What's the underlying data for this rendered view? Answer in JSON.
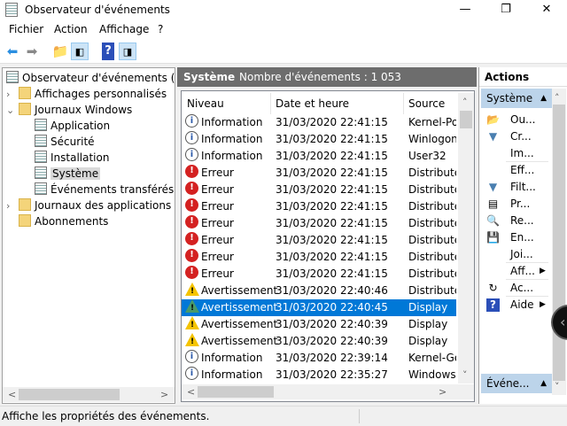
{
  "window": {
    "title": "Observateur d'événements",
    "minimize": "—",
    "maximize": "❐",
    "close": "✕"
  },
  "menu": [
    "Fichier",
    "Action",
    "Affichage",
    "?"
  ],
  "tree": [
    {
      "label": "Observateur d'événements (Local)",
      "level": 0,
      "icon": "event-viewer-icon"
    },
    {
      "label": "Affichages personnalisés",
      "level": 1,
      "icon": "folder-filter-icon",
      "chevron": "›"
    },
    {
      "label": "Journaux Windows",
      "level": 1,
      "icon": "folder-windows-icon",
      "chevron": "⌄"
    },
    {
      "label": "Application",
      "level": 2,
      "icon": "log-warning-icon"
    },
    {
      "label": "Sécurité",
      "level": 2,
      "icon": "log-warning-icon"
    },
    {
      "label": "Installation",
      "level": 2,
      "icon": "log-icon"
    },
    {
      "label": "Système",
      "level": 2,
      "icon": "log-warning-icon",
      "selected": true
    },
    {
      "label": "Événements transférés",
      "level": 2,
      "icon": "log-icon"
    },
    {
      "label": "Journaux des applications et services",
      "level": 1,
      "icon": "folder-icon",
      "chevron": "›"
    },
    {
      "label": "Abonnements",
      "level": 1,
      "icon": "subscriptions-icon"
    }
  ],
  "middle": {
    "title": "Système",
    "count": "Nombre d'événements : 1 053",
    "columns": [
      "Niveau",
      "Date et heure",
      "Source"
    ],
    "rows": [
      {
        "level": "Information",
        "type": "info",
        "date": "31/03/2020 22:41:15",
        "source": "Kernel-Power"
      },
      {
        "level": "Information",
        "type": "info",
        "date": "31/03/2020 22:41:15",
        "source": "Winlogon"
      },
      {
        "level": "Information",
        "type": "info",
        "date": "31/03/2020 22:41:15",
        "source": "User32"
      },
      {
        "level": "Erreur",
        "type": "err",
        "date": "31/03/2020 22:41:15",
        "source": "DistributedCOM"
      },
      {
        "level": "Erreur",
        "type": "err",
        "date": "31/03/2020 22:41:15",
        "source": "DistributedCOM"
      },
      {
        "level": "Erreur",
        "type": "err",
        "date": "31/03/2020 22:41:15",
        "source": "DistributedCOM"
      },
      {
        "level": "Erreur",
        "type": "err",
        "date": "31/03/2020 22:41:15",
        "source": "DistributedCOM"
      },
      {
        "level": "Erreur",
        "type": "err",
        "date": "31/03/2020 22:41:15",
        "source": "DistributedCOM"
      },
      {
        "level": "Erreur",
        "type": "err",
        "date": "31/03/2020 22:41:15",
        "source": "DistributedCOM"
      },
      {
        "level": "Erreur",
        "type": "err",
        "date": "31/03/2020 22:41:15",
        "source": "DistributedCOM"
      },
      {
        "level": "Avertissement",
        "type": "warn",
        "date": "31/03/2020 22:40:46",
        "source": "DistributedCOM"
      },
      {
        "level": "Avertissement",
        "type": "warn",
        "date": "31/03/2020 22:40:45",
        "source": "Display",
        "selected": true
      },
      {
        "level": "Avertissement",
        "type": "warn",
        "date": "31/03/2020 22:40:39",
        "source": "Display"
      },
      {
        "level": "Avertissement",
        "type": "warn",
        "date": "31/03/2020 22:40:39",
        "source": "Display"
      },
      {
        "level": "Information",
        "type": "info",
        "date": "31/03/2020 22:39:14",
        "source": "Kernel-General"
      },
      {
        "level": "Information",
        "type": "info",
        "date": "31/03/2020 22:35:27",
        "source": "WindowsUpdateClient"
      }
    ]
  },
  "actions": {
    "title": "Actions",
    "group1": "Système",
    "group2": "Événe...",
    "items": [
      {
        "label": "Ou...",
        "icon": "open-folder-icon",
        "glyph": "📂"
      },
      {
        "label": "Cr...",
        "icon": "create-filter-icon",
        "glyph": "▼"
      },
      {
        "label": "Im...",
        "icon": "",
        "glyph": ""
      },
      {
        "sep": true
      },
      {
        "label": "Eff...",
        "icon": "",
        "glyph": ""
      },
      {
        "label": "Filt...",
        "icon": "filter-icon",
        "glyph": "▼"
      },
      {
        "label": "Pr...",
        "icon": "properties-icon",
        "glyph": "▤"
      },
      {
        "label": "Re...",
        "icon": "find-icon",
        "glyph": "🔍"
      },
      {
        "label": "En...",
        "icon": "save-icon",
        "glyph": "💾"
      },
      {
        "label": "Joi...",
        "icon": "",
        "glyph": ""
      },
      {
        "sep": true
      },
      {
        "label": "Aff...",
        "icon": "",
        "glyph": "",
        "submenu": true
      },
      {
        "sep": true
      },
      {
        "label": "Ac...",
        "icon": "refresh-icon",
        "glyph": "↻"
      },
      {
        "sep": true
      },
      {
        "label": "Aide",
        "icon": "help-icon",
        "glyph": "?",
        "submenu": true
      }
    ]
  },
  "status": "Affiche les propriétés des événements."
}
